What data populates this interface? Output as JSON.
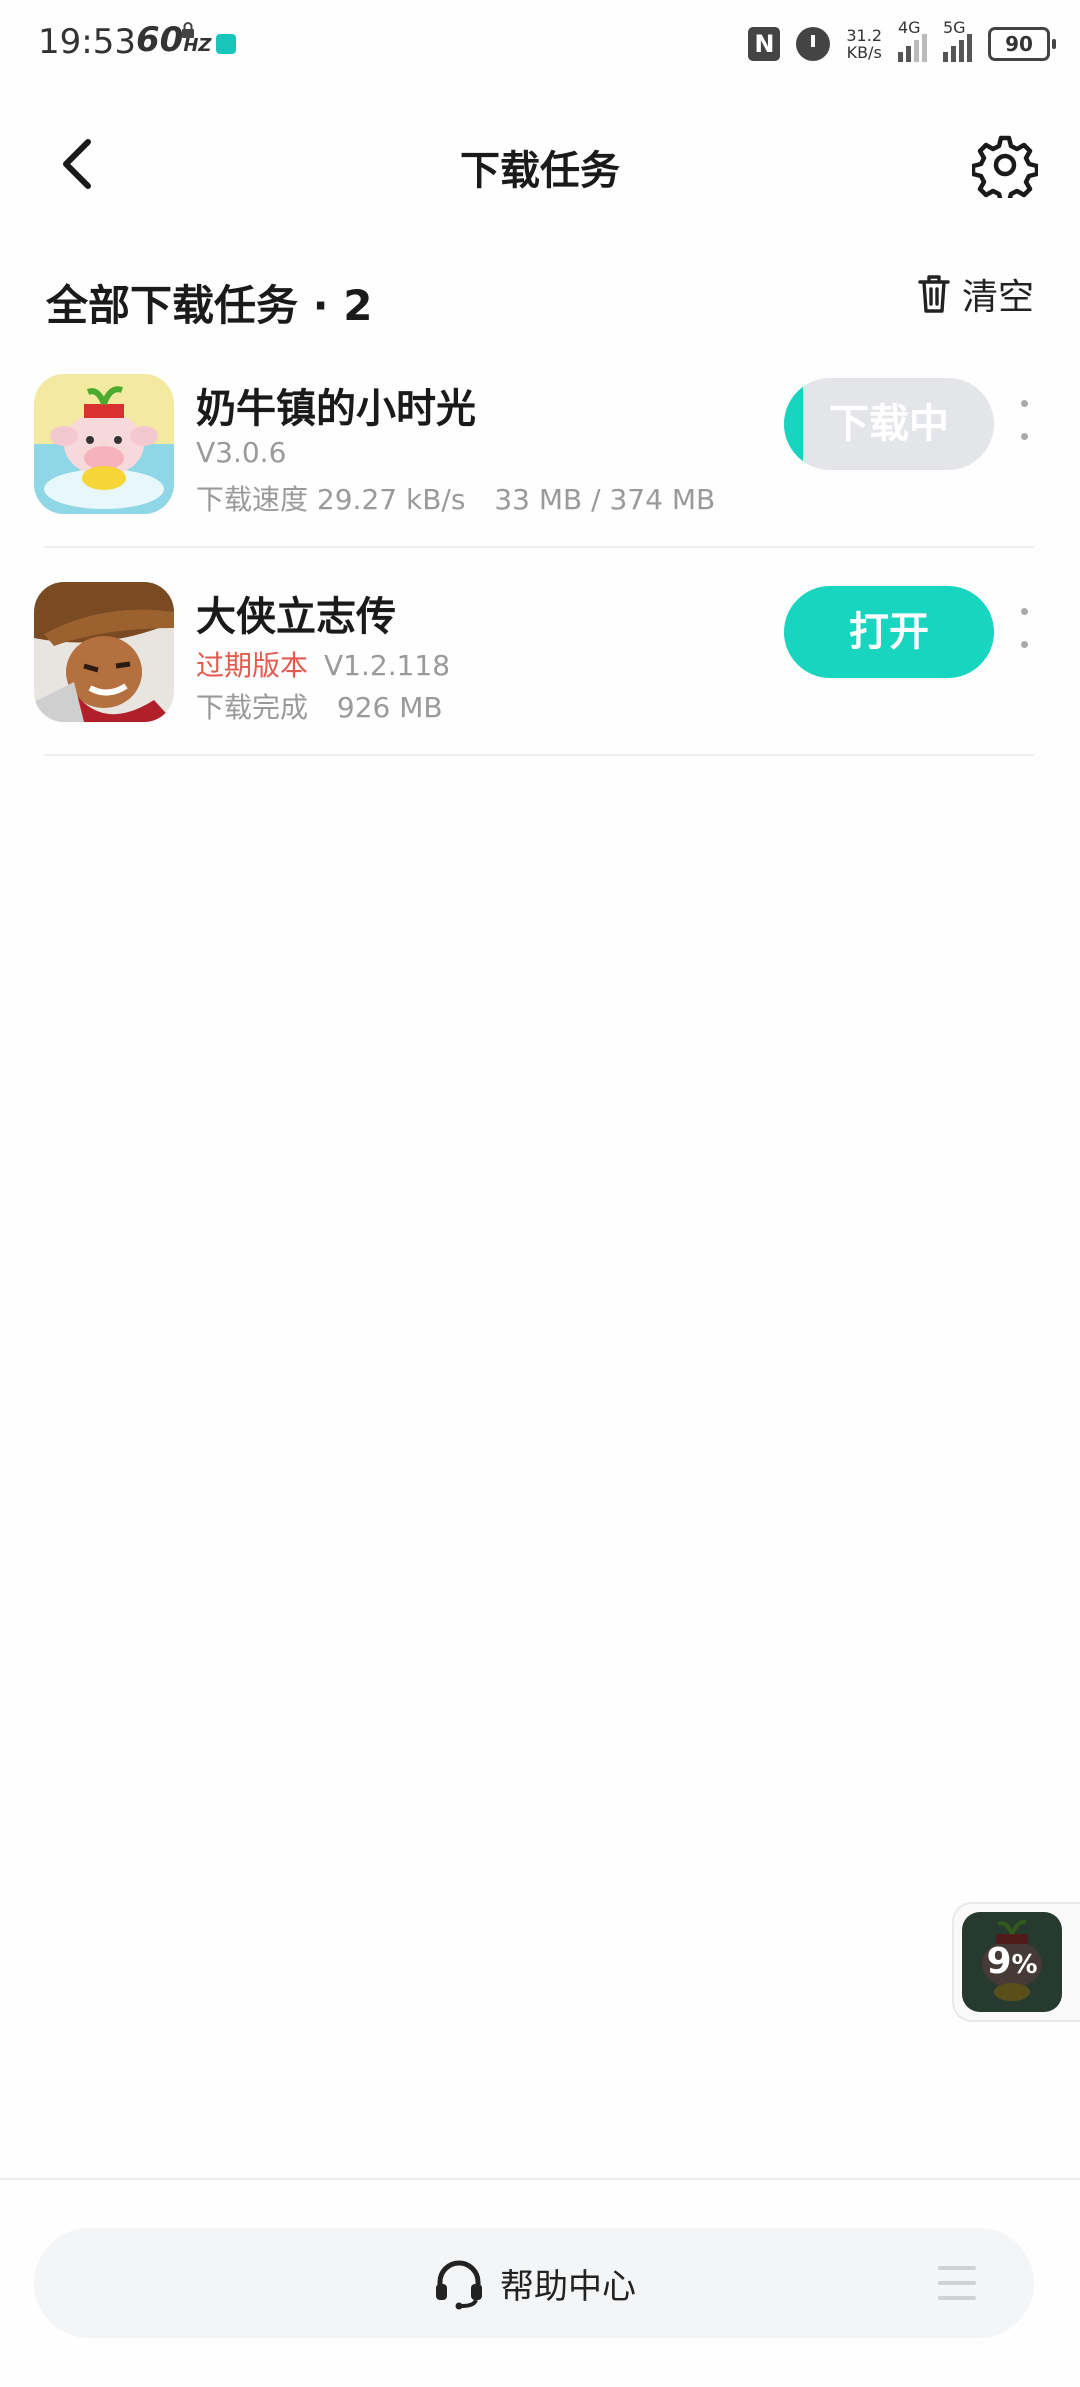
{
  "status_bar": {
    "time": "19:53",
    "refresh_rate": "60",
    "refresh_unit": "HZ",
    "net_speed_value": "31.2",
    "net_speed_unit": "KB/s",
    "signal1_label": "4G",
    "signal2_label": "5G",
    "battery": "90"
  },
  "header": {
    "title": "下载任务"
  },
  "section": {
    "title": "全部下载任务 · 2",
    "clear_label": "清空"
  },
  "tasks": [
    {
      "name": "奶牛镇的小时光",
      "version": "V3.0.6",
      "speed_label": "下载速度",
      "speed": "29.27 kB/s",
      "progress_text": "33 MB / 374 MB",
      "button_label": "下载中",
      "progress": 0.09
    },
    {
      "name": "大侠立志传",
      "expired_label": "过期版本",
      "version": "V1.2.118",
      "status": "下载完成",
      "size": "926 MB",
      "button_label": "打开"
    }
  ],
  "floating_download": {
    "percent": "9",
    "percent_sign": "%"
  },
  "bottom": {
    "help_label": "帮助中心"
  },
  "colors": {
    "accent": "#18d5c0",
    "expired": "#e35b4f",
    "button_disabled": "#e3e5e8"
  }
}
